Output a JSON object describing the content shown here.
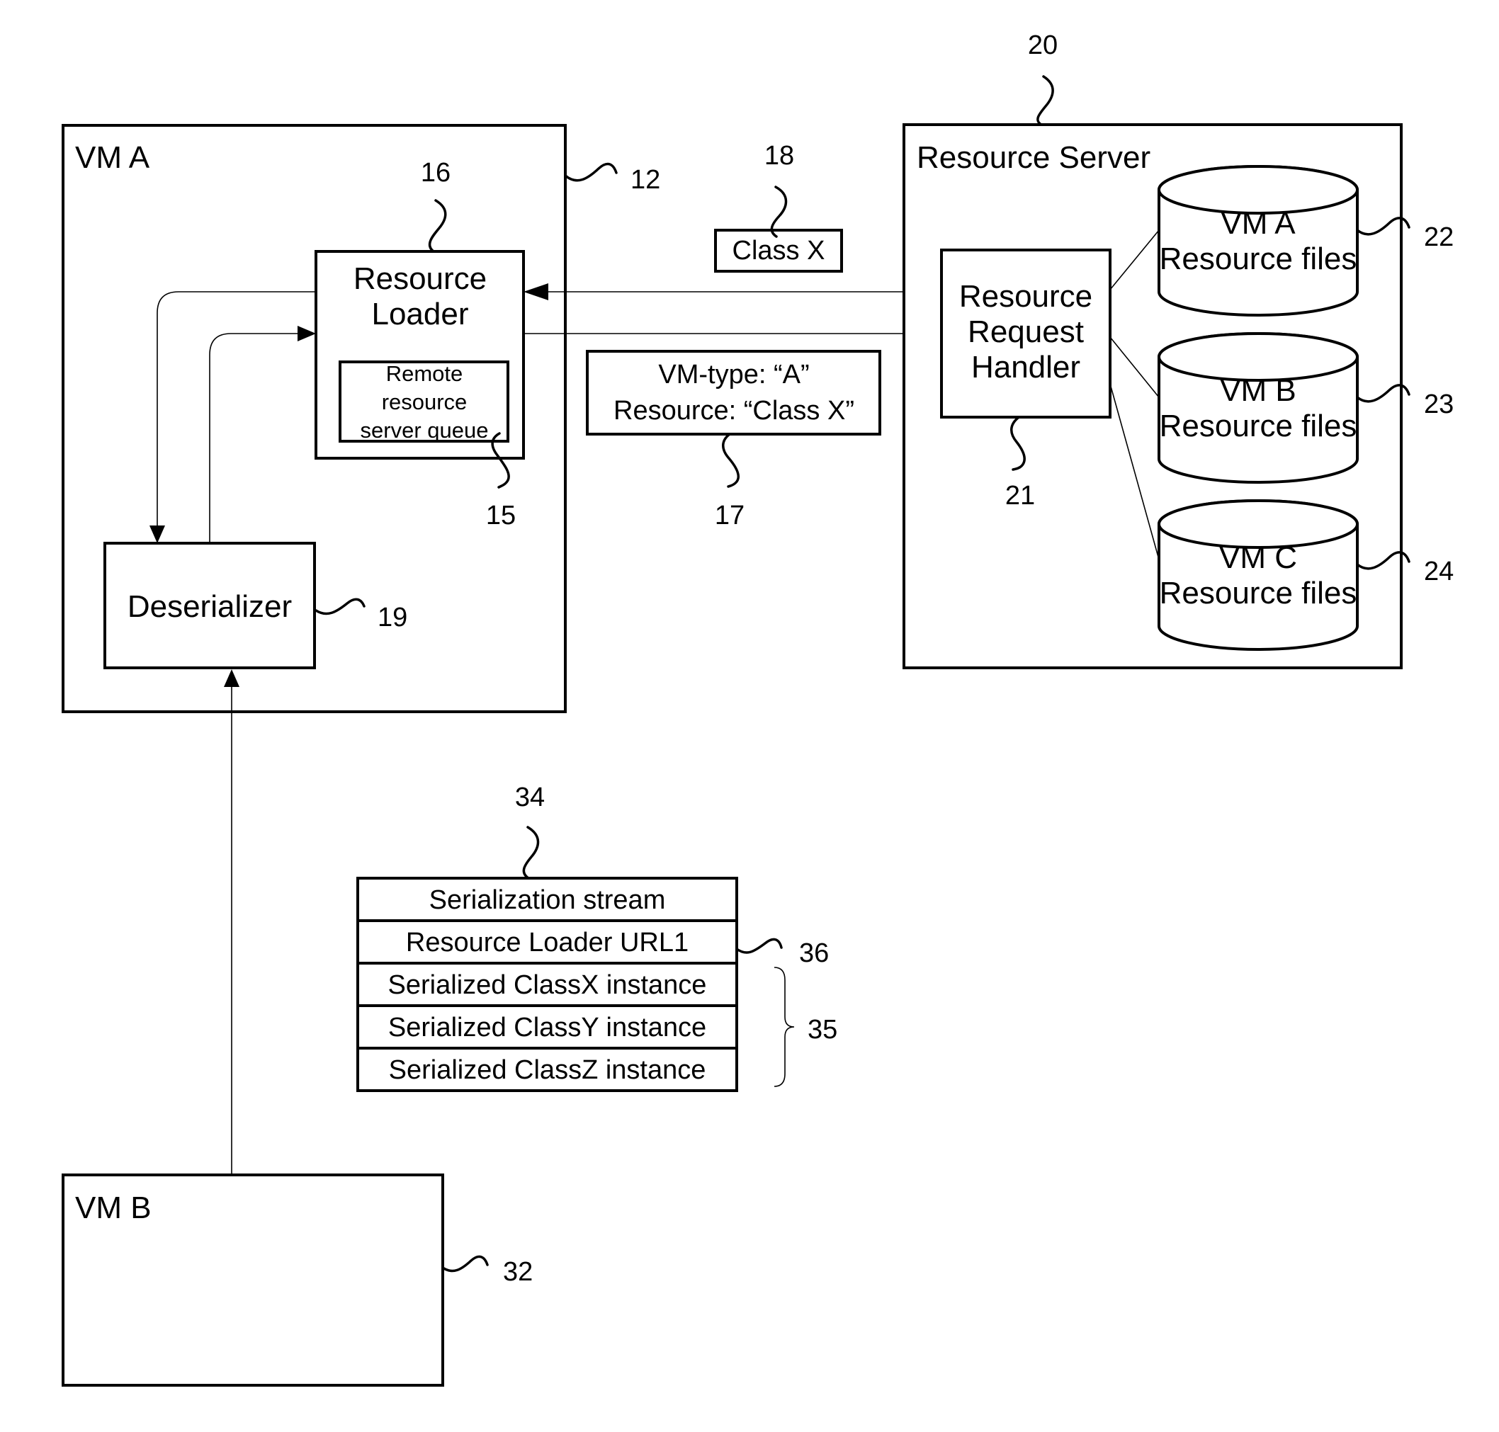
{
  "diagram": {
    "vm_a": {
      "title": "VM A",
      "ref": "12",
      "resource_loader": {
        "lines": [
          "Resource",
          "Loader"
        ],
        "ref": "16",
        "queue": {
          "lines": [
            "Remote",
            "resource",
            "server queue"
          ],
          "ref": "15"
        }
      },
      "deserializer": {
        "label": "Deserializer",
        "ref": "19"
      }
    },
    "class_x_message": {
      "label": "Class X",
      "ref": "18"
    },
    "request_message": {
      "lines": [
        "VM-type: “A”",
        "Resource: “Class X”"
      ],
      "ref": "17"
    },
    "resource_server": {
      "title": "Resource Server",
      "ref": "20",
      "request_handler": {
        "lines": [
          "Resource",
          "Request",
          "Handler"
        ],
        "ref": "21"
      },
      "stores": [
        {
          "lines": [
            "VM A",
            "Resource files"
          ],
          "ref": "22"
        },
        {
          "lines": [
            "VM B",
            "Resource files"
          ],
          "ref": "23"
        },
        {
          "lines": [
            "VM C",
            "Resource files"
          ],
          "ref": "24"
        }
      ]
    },
    "serialization_stream": {
      "ref": "34",
      "rows": [
        "Serialization stream",
        "Resource Loader URL1",
        "Serialized ClassX instance",
        "Serialized ClassY instance",
        "Serialized ClassZ instance"
      ],
      "url_ref": "36",
      "instances_ref": "35"
    },
    "vm_b": {
      "title": "VM B",
      "ref": "32"
    }
  }
}
